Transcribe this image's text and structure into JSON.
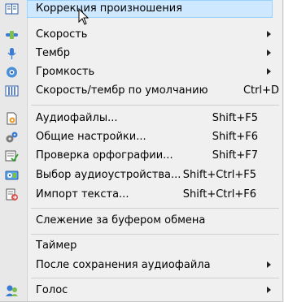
{
  "menu": {
    "items": [
      {
        "label": "Коррекция произношения",
        "shortcut": "",
        "submenu": false,
        "icon": "book-icon",
        "highlighted": true
      },
      {
        "label": "Скорость",
        "shortcut": "",
        "submenu": true,
        "icon": "speed-icon"
      },
      {
        "label": "Тембр",
        "shortcut": "",
        "submenu": true,
        "icon": "microphone-icon"
      },
      {
        "label": "Громкость",
        "shortcut": "",
        "submenu": true,
        "icon": "volume-icon"
      },
      {
        "label": "Скорость/тембр по умолчанию",
        "shortcut": "Ctrl+D",
        "submenu": false,
        "icon": "equalizer-icon"
      },
      {
        "label": "Аудиофайлы...",
        "shortcut": "Shift+F5",
        "submenu": false,
        "icon": "audio-file-icon"
      },
      {
        "label": "Общие настройки...",
        "shortcut": "Shift+F6",
        "submenu": false,
        "icon": "settings-icon"
      },
      {
        "label": "Проверка орфографии...",
        "shortcut": "Shift+F7",
        "submenu": false,
        "icon": "spellcheck-icon"
      },
      {
        "label": "Выбор аудиоустройства...",
        "shortcut": "Shift+Ctrl+F5",
        "submenu": false,
        "icon": "audio-device-icon"
      },
      {
        "label": "Импорт текста...",
        "shortcut": "Shift+Ctrl+F6",
        "submenu": false,
        "icon": "import-text-icon"
      },
      {
        "label": "Слежение за буфером обмена",
        "shortcut": "",
        "submenu": false,
        "icon": ""
      },
      {
        "label": "Таймер",
        "shortcut": "",
        "submenu": false,
        "icon": ""
      },
      {
        "label": "После сохранения аудиофайла",
        "shortcut": "",
        "submenu": true,
        "icon": ""
      },
      {
        "label": "Голос",
        "shortcut": "",
        "submenu": true,
        "icon": "voice-icon"
      }
    ]
  },
  "colors": {
    "highlight_bg": "#cde8ff",
    "highlight_border": "#99d1ff",
    "menu_bg": "#f0f0f0"
  }
}
